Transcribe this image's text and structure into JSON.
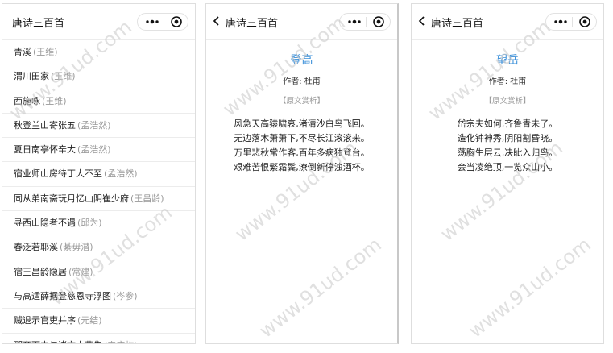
{
  "list_page": {
    "title": "唐诗三百首",
    "items": [
      {
        "title": "青溪",
        "author": "王维"
      },
      {
        "title": "渭川田家",
        "author": "王维"
      },
      {
        "title": "西施咏",
        "author": "王维"
      },
      {
        "title": "秋登兰山寄张五",
        "author": "孟浩然"
      },
      {
        "title": "夏日南亭怀辛大",
        "author": "孟浩然"
      },
      {
        "title": "宿业师山房待丁大不至",
        "author": "孟浩然"
      },
      {
        "title": "同从弟南斋玩月忆山阴崔少府",
        "author": "王昌龄"
      },
      {
        "title": "寻西山隐者不遇",
        "author": "邱为"
      },
      {
        "title": "春泛若耶溪",
        "author": "綦毋潜"
      },
      {
        "title": "宿王昌龄隐居",
        "author": "常建"
      },
      {
        "title": "与高适薛据登慈恩寺浮图",
        "author": "岑参"
      },
      {
        "title": "贼退示官吏并序",
        "author": "元结"
      },
      {
        "title": "郡斋雨中与诸文士燕集",
        "author": "韦应物"
      }
    ]
  },
  "detail_pages": [
    {
      "nav_title": "唐诗三百首",
      "poem_title": "登高",
      "author_label": "作者:",
      "author": "杜甫",
      "appreciate_label": "原文赏析",
      "lines": [
        "风急天高猿啸哀,渚清沙白鸟飞回。",
        "无边落木萧萧下,不尽长江滚滚来。",
        "万里悲秋常作客,百年多病独登台。",
        "艰难苦恨繁霜鬓,潦倒新停浊酒杯。"
      ]
    },
    {
      "nav_title": "唐诗三百首",
      "poem_title": "望岳",
      "author_label": "作者:",
      "author": "杜甫",
      "appreciate_label": "原文赏析",
      "lines": [
        "岱宗夫如何,齐鲁青未了。",
        "造化钟神秀,阴阳割昏晓。",
        "荡胸生层云,决眦入归鸟。",
        "会当凌绝顶,一览众山小。"
      ]
    }
  ],
  "icons": {
    "back": "chevron-left-icon",
    "more": "more-dots-icon",
    "close": "target-close-icon"
  },
  "colors": {
    "title_accent": "#3a8fd9",
    "muted": "#999999"
  },
  "watermark_text": "www.91ud.com"
}
